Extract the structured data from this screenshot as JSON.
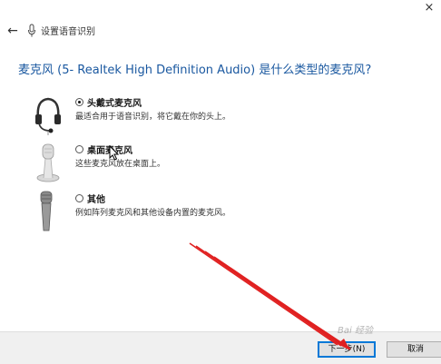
{
  "window": {
    "title": "设置语音识别",
    "back_glyph": "←",
    "close_glyph": "×"
  },
  "question": "麦克风 (5- Realtek High Definition Audio) 是什么类型的麦克风?",
  "options": [
    {
      "label": "头戴式麦克风",
      "description": "最适合用于语音识别，将它戴在你的头上。",
      "selected": true,
      "icon": "headset-icon"
    },
    {
      "label": "桌面麦克风",
      "description": "这些麦克风放在桌面上。",
      "selected": false,
      "icon": "desktop-mic-icon"
    },
    {
      "label": "其他",
      "description": "例如阵列麦克风和其他设备内置的麦克风。",
      "selected": false,
      "icon": "handheld-mic-icon"
    }
  ],
  "buttons": {
    "next_label": "下一步(N)",
    "cancel_label": "取消"
  },
  "watermark": "Bai 经验",
  "colors": {
    "accent": "#0078d7",
    "question_text": "#1a58a0",
    "annotation_arrow": "#e02020",
    "footer_bg": "#f0f0f0"
  }
}
